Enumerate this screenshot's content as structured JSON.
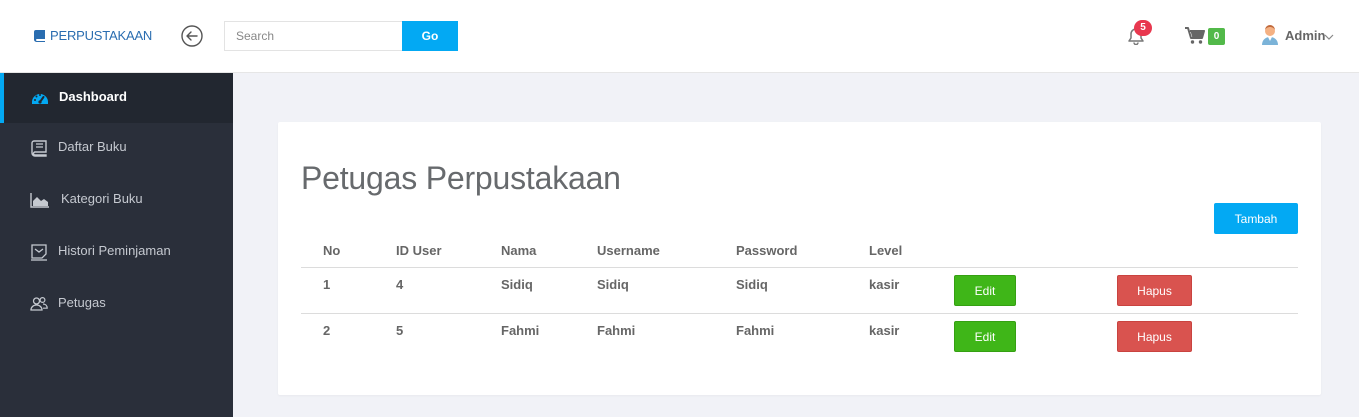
{
  "header": {
    "brand": "PERPUSTAKAAN",
    "search_placeholder": "Search",
    "search_button": "Go",
    "notification_count": "5",
    "cart_count": "0",
    "user_name": "Admin"
  },
  "sidebar": {
    "items": [
      {
        "label": "Dashboard",
        "icon": "dashboard-icon",
        "active": true
      },
      {
        "label": "Daftar Buku",
        "icon": "book-icon"
      },
      {
        "label": "Kategori Buku",
        "icon": "area-chart-icon"
      },
      {
        "label": "Histori Peminjaman",
        "icon": "history-icon"
      },
      {
        "label": "Petugas",
        "icon": "users-icon"
      }
    ]
  },
  "main": {
    "title": "Petugas Perpustakaan",
    "add_button": "Tambah",
    "table": {
      "columns": [
        "No",
        "ID User",
        "Nama",
        "Username",
        "Password",
        "Level"
      ],
      "rows": [
        {
          "no": "1",
          "id_user": "4",
          "nama": "Sidiq",
          "username": "Sidiq",
          "password": "Sidiq",
          "level": "kasir",
          "edit": "Edit",
          "delete": "Hapus"
        },
        {
          "no": "2",
          "id_user": "5",
          "nama": "Fahmi",
          "username": "Fahmi",
          "password": "Fahmi",
          "level": "kasir",
          "edit": "Edit",
          "delete": "Hapus"
        }
      ]
    }
  },
  "colors": {
    "primary": "#03a9f3",
    "sidebar_bg": "#2a2f3a",
    "success": "#3fb618",
    "danger": "#d9534f",
    "badge_red": "#e8384f",
    "badge_green": "#52b949"
  }
}
